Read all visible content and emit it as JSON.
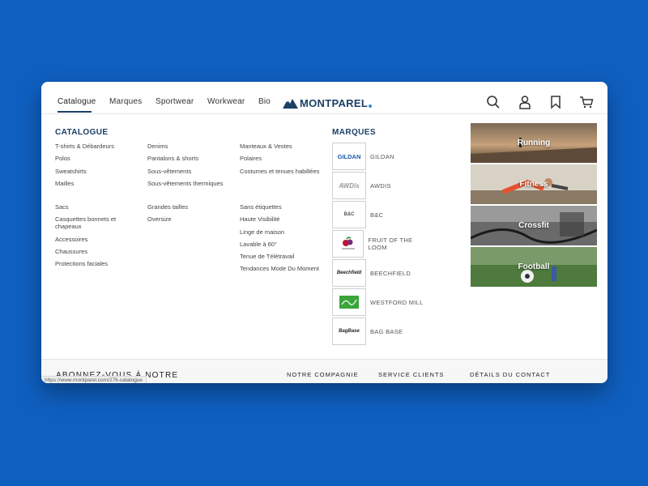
{
  "nav": {
    "items": [
      "Catalogue",
      "Marques",
      "Sportwear",
      "Workwear",
      "Bio"
    ],
    "logo_text": "MONTPAREL"
  },
  "catalogue": {
    "title": "CATALOGUE",
    "col1": [
      "T-shirts & Débardeurs",
      "Polos",
      "Sweatshirts",
      "Mailles"
    ],
    "col1b": [
      "Sacs",
      "Casquettes bonnets et chapeaux",
      "Accessoires",
      "Chaussures",
      "Protections faciales"
    ],
    "col2": [
      "Denims",
      "Pantalons & shorts",
      "Sous-vêtements",
      "Sous-vêtements thermiques"
    ],
    "col2b": [
      "Grandes tailles",
      "Oversize"
    ],
    "col3": [
      "Manteaux & Vestes",
      "Polaires",
      "Costumes et tenues habillées"
    ],
    "col3b": [
      "Sans étiquettes",
      "Haute Visibilité",
      "Linge de maison",
      "Lavable à 60°",
      "Tenue de Télétravail",
      "Tendances Mode Du Moment"
    ]
  },
  "brands": {
    "title": "MARQUES",
    "items": [
      {
        "name": "GILDAN",
        "logo": "GILDAN"
      },
      {
        "name": "AWDIS",
        "logo": "AWDis"
      },
      {
        "name": "B&C",
        "logo": "B&C"
      },
      {
        "name": "FRUIT OF THE LOOM",
        "logo": ""
      },
      {
        "name": "BEECHFIELD",
        "logo": "Beechfield"
      },
      {
        "name": "WESTFORD MILL",
        "logo": ""
      },
      {
        "name": "BAG BASE",
        "logo": "BagBase"
      }
    ]
  },
  "sports": [
    "Running",
    "Fitness",
    "Crossfit",
    "Football"
  ],
  "footer": {
    "title": "ABONNEZ-VOUS À NOTRE",
    "links": [
      "NOTRE COMPAGNIE",
      "SERVICE CLIENTS",
      "DÉTAILS DU CONTACT"
    ],
    "status_url": "https://www.montparel.com/276-catalogue"
  }
}
